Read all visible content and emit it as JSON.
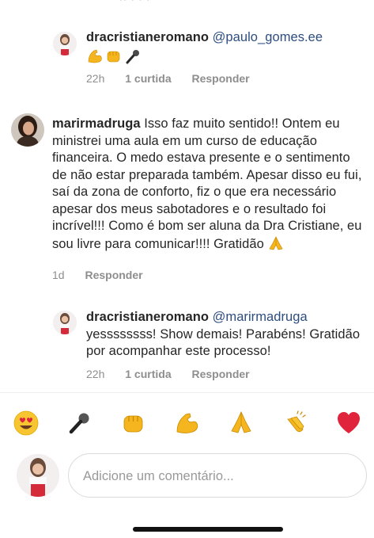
{
  "comments": [
    {
      "username": "dracristianeromano",
      "mention": "@paulo_gomes.ee",
      "text": "",
      "time": "22h",
      "likes": "1 curtida",
      "reply": "Responder"
    },
    {
      "username": "marirmadruga",
      "mention": "",
      "text": "Isso faz muito sentido!! Ontem eu ministrei uma aula em um curso de educação financeira. O medo estava presente e o sentimento de não estar preparada também. Apesar disso eu fui, saí da zona de conforto, fiz o que era necessário apesar dos meus sabotadores e o resultado foi incrível!!! Como é bom ser aluna da Dra Cristiane, eu sou livre para comunicar!!!! Gratidão",
      "time": "1d",
      "reply": "Responder"
    },
    {
      "username": "dracristianeromano",
      "mention": "@marirmadruga",
      "text": "yessssssss! Show demais! Parabéns! Gratidão por acompanhar este processo!",
      "time": "22h",
      "likes": "1 curtida",
      "reply": "Responder"
    }
  ],
  "emoji_bar": [
    "heart-eyes-emoji",
    "microphone-emoji",
    "fist-emoji",
    "flexed-biceps-emoji",
    "folded-hands-emoji",
    "clapping-hands-emoji",
    "red-heart-emoji"
  ],
  "composer": {
    "placeholder": "Adicione um comentário..."
  }
}
